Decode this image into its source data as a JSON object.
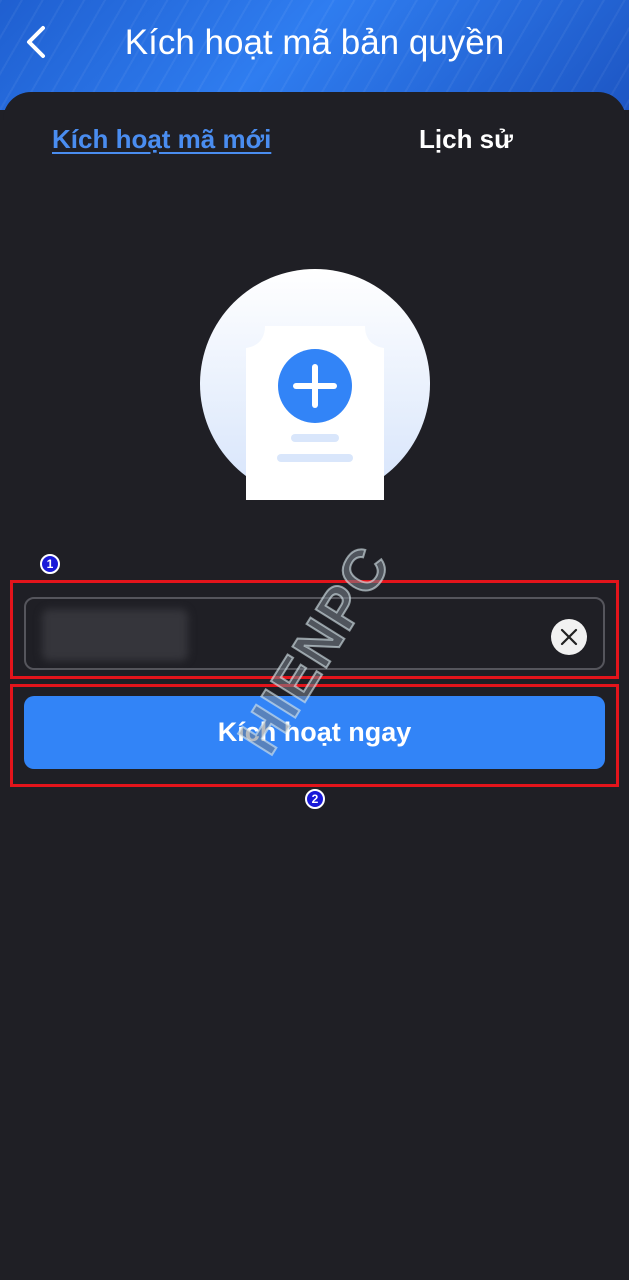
{
  "header": {
    "title": "Kích hoạt mã bản quyền"
  },
  "tabs": [
    {
      "label": "Kích hoạt mã mới",
      "active": true
    },
    {
      "label": "Lịch sử",
      "active": false
    }
  ],
  "illustration": {
    "icon": "document-plus-icon"
  },
  "license_input": {
    "value": "",
    "clear_icon": "close-icon"
  },
  "activate_button": {
    "label": "Kích hoạt ngay"
  },
  "annotations": {
    "step1": "1",
    "step2": "2"
  },
  "watermark": {
    "text": "HIENPC"
  },
  "colors": {
    "accent": "#3284f7",
    "background": "#1f1f25",
    "highlight": "#e3141b"
  }
}
